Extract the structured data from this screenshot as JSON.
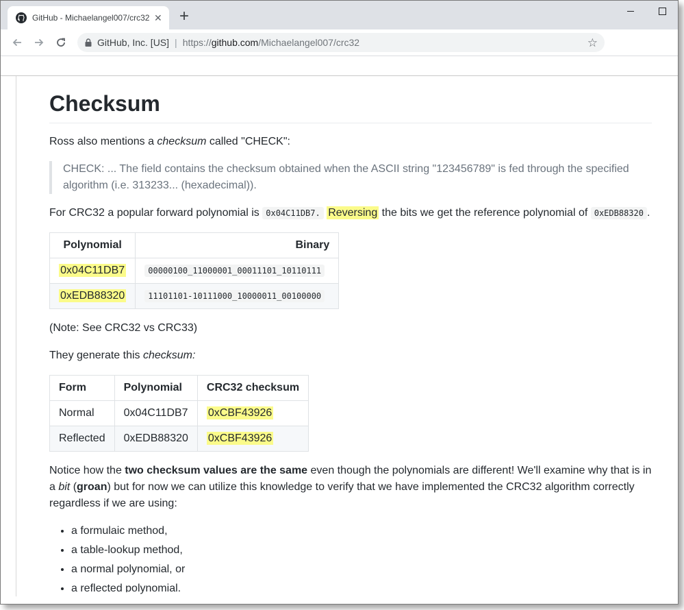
{
  "browser": {
    "tab_title": "GitHub - Michaelangel007/crc32",
    "tab_close": "✕",
    "new_tab": "+",
    "site_identity": "GitHub, Inc. [US]",
    "url_scheme": "https://",
    "url_host": "github.com",
    "url_path": "/Michaelangel007/crc32"
  },
  "page": {
    "title": "Checksum",
    "intro": {
      "a": "Ross also mentions a ",
      "em": "checksum",
      "b": " called \"CHECK\":"
    },
    "quote": "CHECK: ... The field contains the checksum obtained when the ASCII string \"123456789\" is fed through the specified algorithm (i.e. 313233... (hexadecimal)).",
    "poly_line": {
      "a": "For CRC32 a popular forward polynomial is ",
      "code1": "0x04C11DB7.",
      "hl": "Reversing",
      "b": " the bits we get the reference polynomial of ",
      "code2": "0xEDB88320",
      "c": "."
    },
    "table1": {
      "headers": [
        "Polynomial",
        "Binary"
      ],
      "rows": [
        [
          "0x04C11DB7",
          "00000100_11000001_00011101_10110111"
        ],
        [
          "0xEDB88320",
          "11101101-10111000_10000011_00100000"
        ]
      ]
    },
    "note": "(Note: See CRC32 vs CRC33)",
    "generate": {
      "a": "They generate this ",
      "em": "checksum:"
    },
    "table2": {
      "headers": [
        "Form",
        "Polynomial",
        "CRC32 checksum"
      ],
      "rows": [
        [
          "Normal",
          "0x04C11DB7",
          "0xCBF43926"
        ],
        [
          "Reflected",
          "0xEDB88320",
          "0xCBF43926"
        ]
      ]
    },
    "notice": {
      "a": "Notice how the ",
      "strong": "two checksum values are the same",
      "b": " even though the polynomials are different! We'll examine why that is in a ",
      "em": "bit",
      "c": " (",
      "strong2": "groan",
      "d": ") but for now we can utilize this knowledge to verify that we have implemented the CRC32 algorithm correctly regardless if we are using:"
    },
    "list": [
      "a formulaic method,",
      "a table-lookup method,",
      "a normal polynomial, or",
      "a reflected polynomial."
    ]
  },
  "colors": {
    "highlight": "#fbfb8a",
    "text": "#24292e",
    "quote_text": "#6a737d"
  },
  "icons": [
    "github-favicon",
    "close-icon",
    "new-tab-icon",
    "minimize-icon",
    "maximize-icon",
    "back-icon",
    "forward-icon",
    "reload-icon",
    "lock-icon",
    "bookmark-star-icon"
  ]
}
